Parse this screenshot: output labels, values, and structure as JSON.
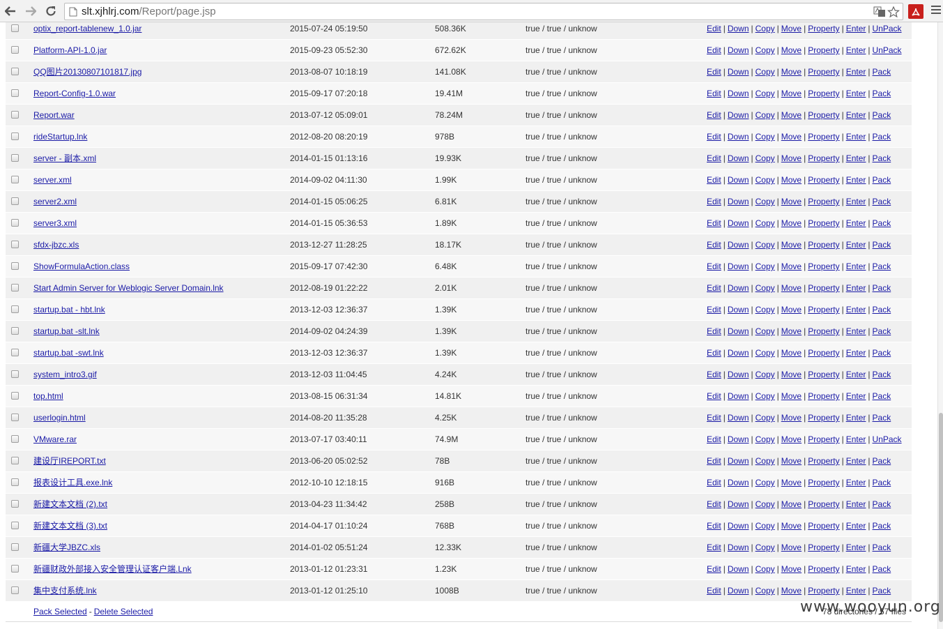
{
  "browser": {
    "address_host": "slt.xjhlrj.com",
    "address_path": "/Report/page.jsp"
  },
  "actions": [
    "Edit",
    "Down",
    "Copy",
    "Move",
    "Property",
    "Enter"
  ],
  "files": [
    {
      "name": "optix_report-tablenew_1.0.jar",
      "date": "2015-07-24 05:19:50",
      "size": "508.36K",
      "perm": "true / true / unknow",
      "last": "UnPack"
    },
    {
      "name": "Platform-API-1.0.jar",
      "date": "2015-09-23 05:52:30",
      "size": "672.62K",
      "perm": "true / true / unknow",
      "last": "UnPack"
    },
    {
      "name": "QQ图片20130807101817.jpg",
      "date": "2013-08-07 10:18:19",
      "size": "141.08K",
      "perm": "true / true / unknow",
      "last": "Pack"
    },
    {
      "name": "Report-Config-1.0.war",
      "date": "2015-09-17 07:20:18",
      "size": "19.41M",
      "perm": "true / true / unknow",
      "last": "Pack"
    },
    {
      "name": "Report.war",
      "date": "2013-07-12 05:09:01",
      "size": "78.24M",
      "perm": "true / true / unknow",
      "last": "Pack"
    },
    {
      "name": "rideStartup.lnk",
      "date": "2012-08-20 08:20:19",
      "size": "978B",
      "perm": "true / true / unknow",
      "last": "Pack"
    },
    {
      "name": "server - 副本.xml",
      "date": "2014-01-15 01:13:16",
      "size": "19.93K",
      "perm": "true / true / unknow",
      "last": "Pack"
    },
    {
      "name": "server.xml",
      "date": "2014-09-02 04:11:30",
      "size": "1.99K",
      "perm": "true / true / unknow",
      "last": "Pack"
    },
    {
      "name": "server2.xml",
      "date": "2014-01-15 05:06:25",
      "size": "6.81K",
      "perm": "true / true / unknow",
      "last": "Pack"
    },
    {
      "name": "server3.xml",
      "date": "2014-01-15 05:36:53",
      "size": "1.89K",
      "perm": "true / true / unknow",
      "last": "Pack"
    },
    {
      "name": "sfdx-jbzc.xls",
      "date": "2013-12-27 11:28:25",
      "size": "18.17K",
      "perm": "true / true / unknow",
      "last": "Pack"
    },
    {
      "name": "ShowFormulaAction.class",
      "date": "2015-09-17 07:42:30",
      "size": "6.48K",
      "perm": "true / true / unknow",
      "last": "Pack"
    },
    {
      "name": "Start Admin Server for Weblogic Server Domain.lnk",
      "date": "2012-08-19 01:22:22",
      "size": "2.01K",
      "perm": "true / true / unknow",
      "last": "Pack"
    },
    {
      "name": "startup.bat - hbt.lnk",
      "date": "2013-12-03 12:36:37",
      "size": "1.39K",
      "perm": "true / true / unknow",
      "last": "Pack"
    },
    {
      "name": "startup.bat -slt.lnk",
      "date": "2014-09-02 04:24:39",
      "size": "1.39K",
      "perm": "true / true / unknow",
      "last": "Pack"
    },
    {
      "name": "startup.bat -swt.lnk",
      "date": "2013-12-03 12:36:37",
      "size": "1.39K",
      "perm": "true / true / unknow",
      "last": "Pack"
    },
    {
      "name": "system_intro3.gif",
      "date": "2013-12-03 11:04:45",
      "size": "4.24K",
      "perm": "true / true / unknow",
      "last": "Pack"
    },
    {
      "name": "top.html",
      "date": "2013-08-15 06:31:34",
      "size": "14.81K",
      "perm": "true / true / unknow",
      "last": "Pack"
    },
    {
      "name": "userlogin.html",
      "date": "2014-08-20 11:35:28",
      "size": "4.25K",
      "perm": "true / true / unknow",
      "last": "Pack"
    },
    {
      "name": "VMware.rar",
      "date": "2013-07-17 03:40:11",
      "size": "74.9M",
      "perm": "true / true / unknow",
      "last": "UnPack"
    },
    {
      "name": "建设厅IREPORT.txt",
      "date": "2013-06-20 05:02:52",
      "size": "78B",
      "perm": "true / true / unknow",
      "last": "Pack"
    },
    {
      "name": "报表设计工具.exe.lnk",
      "date": "2012-10-10 12:18:15",
      "size": "916B",
      "perm": "true / true / unknow",
      "last": "Pack"
    },
    {
      "name": "新建文本文档 (2).txt",
      "date": "2013-04-23 11:34:42",
      "size": "258B",
      "perm": "true / true / unknow",
      "last": "Pack"
    },
    {
      "name": "新建文本文档 (3).txt",
      "date": "2014-04-17 01:10:24",
      "size": "768B",
      "perm": "true / true / unknow",
      "last": "Pack"
    },
    {
      "name": "新疆大学JBZC.xls",
      "date": "2014-01-02 05:51:24",
      "size": "12.33K",
      "perm": "true / true / unknow",
      "last": "Pack"
    },
    {
      "name": "新疆财政外部接入安全管理认证客户端.Lnk",
      "date": "2013-01-12 01:23:31",
      "size": "1.23K",
      "perm": "true / true / unknow",
      "last": "Pack"
    },
    {
      "name": "集中支付系统.lnk",
      "date": "2013-01-12 01:25:10",
      "size": "1008B",
      "perm": "true / true / unknow",
      "last": "Pack"
    }
  ],
  "footer": {
    "pack_selected": "Pack Selected",
    "dash": "-",
    "delete_selected": "Delete Selected",
    "summary": "78 directories / 57 files"
  },
  "watermark": "www.wooyun.org"
}
